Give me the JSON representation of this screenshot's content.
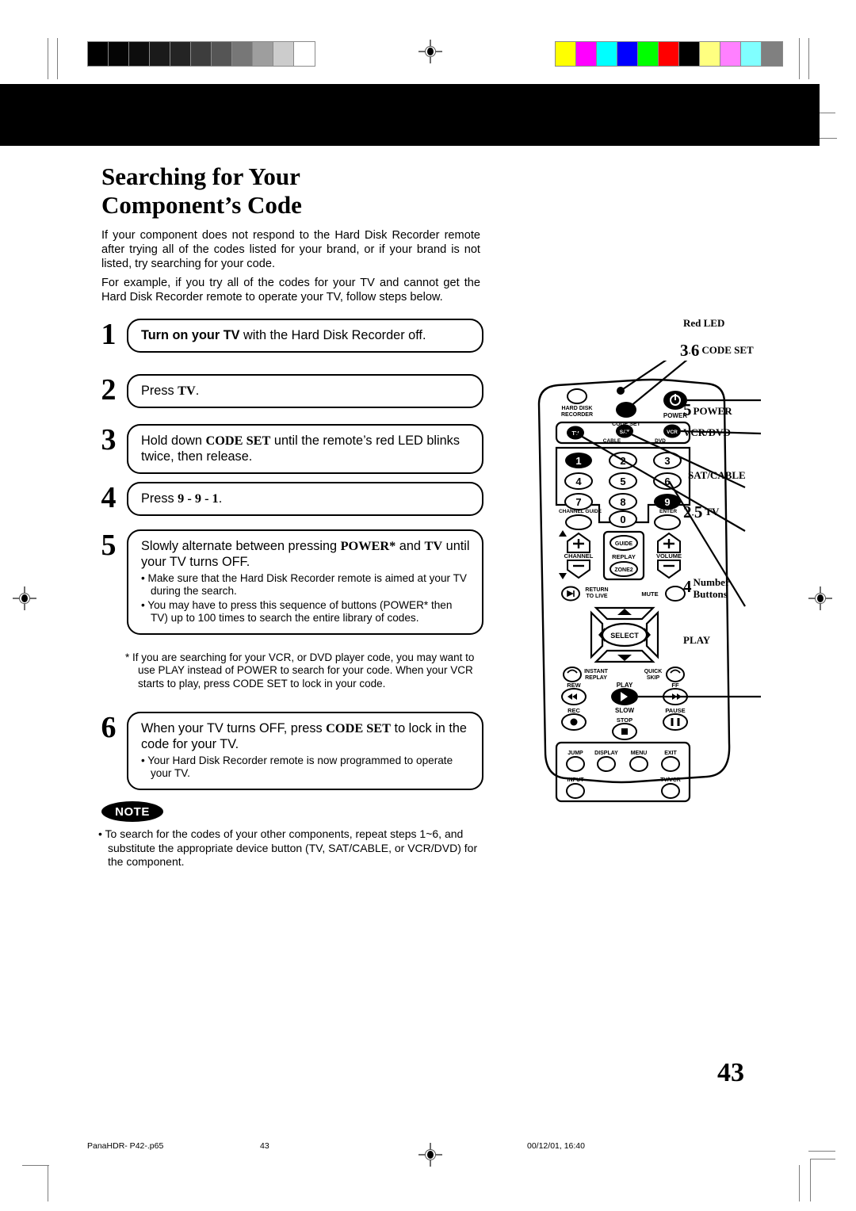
{
  "header": {
    "gray_wedge": [
      "#000000",
      "#050505",
      "#0d0d0d",
      "#1a1a1a",
      "#242424",
      "#3d3d3d",
      "#555555",
      "#777777",
      "#9e9e9e",
      "#cccccc",
      "#ffffff"
    ],
    "color_bar": [
      "#ffff00",
      "#ff00ff",
      "#00ffff",
      "#0000ff",
      "#00ff00",
      "#ff0000",
      "#000000",
      "#ffff80",
      "#ff80ff",
      "#80ffff",
      "#808080"
    ]
  },
  "title": {
    "line1": "Searching for Your",
    "line2": "Component’s Code"
  },
  "intro": {
    "p1": "If your component does not respond to the Hard Disk Recorder remote after trying all of the codes listed for your brand, or if your brand is not listed, try searching for your code.",
    "p2": "For example, if you try all of the codes for your TV and cannot get the Hard Disk Recorder remote to operate your TV, follow steps below."
  },
  "steps": [
    {
      "num": "1",
      "head_bold": "Turn on your TV",
      "head_rest": " with the Hard Disk Recorder off.",
      "bullets": []
    },
    {
      "num": "2",
      "head_pre": "Press ",
      "head_bold": "TV",
      "head_rest": ".",
      "bullets": []
    },
    {
      "num": "3",
      "head_pre": "Hold down ",
      "head_bold": "CODE SET",
      "head_rest": " until the remote’s red LED blinks twice, then release.",
      "bullets": []
    },
    {
      "num": "4",
      "head_pre": "Press ",
      "head_bold": "9 - 9 - 1",
      "head_rest": ".",
      "bullets": []
    },
    {
      "num": "5",
      "head_pre": "Slowly alternate between pressing ",
      "head_bold": "POWER*",
      "head_mid": " and ",
      "head_bold2": "TV",
      "head_rest": " until your TV turns OFF.",
      "bullets": [
        "Make sure that the Hard Disk Recorder remote is aimed at your TV during the search.",
        "You may have to press this sequence of buttons (POWER* then TV) up to 100 times to search the entire library of codes."
      ]
    },
    {
      "num": "6",
      "head_pre": "When your TV turns OFF, press ",
      "head_bold": "CODE SET",
      "head_rest": " to lock in the code for your TV.",
      "bullets": [
        "Your Hard Disk Recorder remote is now programmed to operate your TV."
      ]
    }
  ],
  "footnote": "* If you are searching for your VCR, or DVD player code, you may want to use PLAY instead of POWER to search for your code. When your VCR starts to play, press CODE SET to lock in your code.",
  "note": {
    "badge": "NOTE",
    "body": "• To search for the codes of your other components, repeat steps 1~6, and substitute the appropriate device button (TV, SAT/CABLE, or VCR/DVD) for the component."
  },
  "callouts": [
    {
      "id": "red-led",
      "stack": "",
      "label": "Red LED",
      "size": "sm"
    },
    {
      "id": "code-set",
      "stack": "3/6",
      "label": "CODE SET",
      "size": "sm"
    },
    {
      "id": "power",
      "stack": "5",
      "label": "POWER",
      "size": "sm"
    },
    {
      "id": "vcr-dvd",
      "stack": "",
      "label": "VCR/DVD",
      "size": "sm"
    },
    {
      "id": "sat-cable",
      "stack": "",
      "label": "SAT/CABLE",
      "size": "sm"
    },
    {
      "id": "tv",
      "stack": "2/5",
      "label": "TV",
      "size": "sm"
    },
    {
      "id": "number-btns",
      "stack": "4",
      "label": "Number Buttons",
      "size": "sm"
    },
    {
      "id": "play",
      "stack": "",
      "label": "PLAY",
      "size": "sm"
    }
  ],
  "remote": {
    "hard_disk_recorder": "HARD DISK RECORDER",
    "code_set": "CODE SET",
    "power": "POWER",
    "device_tv": "TV",
    "device_cable": "CABLE",
    "device_sat": "SAT",
    "device_dvd": "DVD",
    "device_vcr": "VCR",
    "numbers": [
      "1",
      "2",
      "3",
      "4",
      "5",
      "6",
      "7",
      "8",
      "9",
      "0"
    ],
    "channel_guide": "CHANNEL GUIDE",
    "enter": "ENTER",
    "channel": "CHANNEL",
    "replay": "REPLAY",
    "volume": "VOLUME",
    "guide": "GUIDE",
    "zone2": "ZONE2",
    "return_to_live": "RETURN TO LIVE",
    "mute": "MUTE",
    "select": "SELECT",
    "instant_replay": "INSTANT REPLAY",
    "quick_skip": "QUICK SKIP",
    "rew": "REW",
    "play": "PLAY",
    "slow": "SLOW",
    "ff": "FF",
    "rec": "REC",
    "stop": "STOP",
    "pause": "PAUSE",
    "jump": "JUMP",
    "display": "DISPLAY",
    "menu": "MENU",
    "exit": "EXIT",
    "input": "INPUT",
    "tv_vcr": "TV/VCR"
  },
  "page_number": "43",
  "footer": {
    "file": "PanaHDR- P42-.p65",
    "page": "43",
    "timestamp": "00/12/01, 16:40"
  }
}
